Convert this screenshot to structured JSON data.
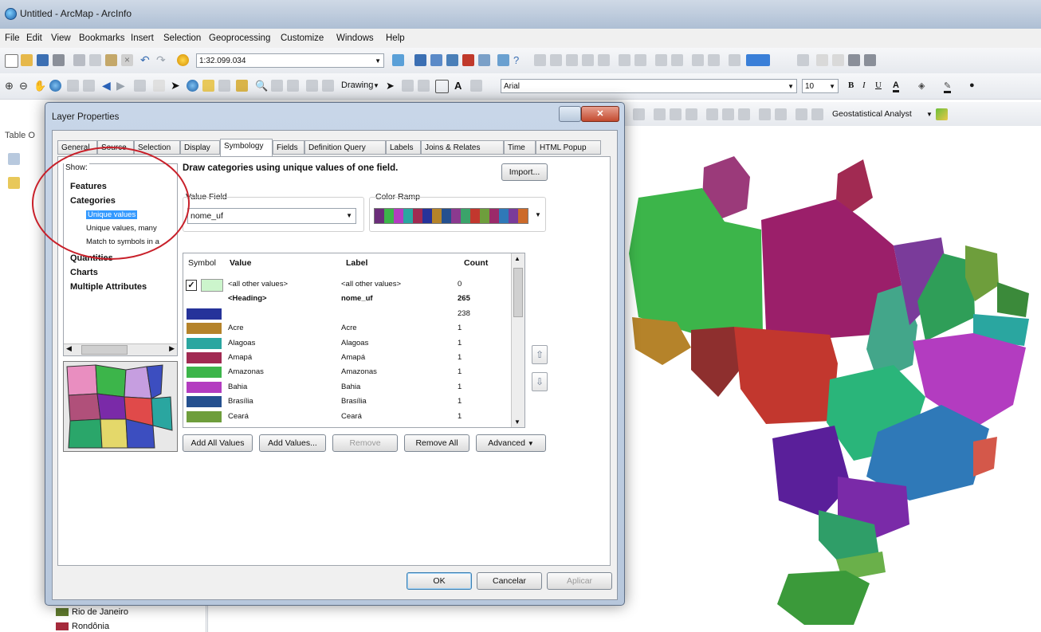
{
  "window": {
    "title": "Untitled - ArcMap - ArcInfo"
  },
  "menu": [
    "File",
    "Edit",
    "View",
    "Bookmarks",
    "Insert",
    "Selection",
    "Geoprocessing",
    "Customize",
    "Windows",
    "Help"
  ],
  "toolbar": {
    "scale": "1:32.099.034",
    "drawing_label": "Drawing",
    "font_name": "Arial",
    "font_size": "10",
    "geostat_label": "Geostatistical Analyst"
  },
  "toc": {
    "title": "Table O",
    "legend_items": [
      {
        "label": "Rio de Janeiro",
        "color": "#5f7a2e"
      },
      {
        "label": "Rondônia",
        "color": "#a52a3b"
      }
    ]
  },
  "dialog": {
    "title": "Layer Properties",
    "tabs": [
      "General",
      "Source",
      "Selection",
      "Display",
      "Symbology",
      "Fields",
      "Definition Query",
      "Labels",
      "Joins & Relates",
      "Time",
      "HTML Popup"
    ],
    "active_tab": "Symbology",
    "show_label": "Show:",
    "show_items": [
      "Features",
      "Categories",
      "Quantities",
      "Charts",
      "Multiple Attributes"
    ],
    "category_subitems": [
      "Unique values",
      "Unique values, many",
      "Match to symbols in a"
    ],
    "selected_subitem": "Unique values",
    "description": "Draw categories using unique values of one field.",
    "import_button": "Import...",
    "value_field_label": "Value Field",
    "value_field": "nome_uf",
    "color_ramp_label": "Color Ramp",
    "columns": [
      "Symbol",
      "Value",
      "Label",
      "Count"
    ],
    "rows": [
      {
        "value": "<all other values>",
        "label": "<all other values>",
        "count": "0",
        "color": "#ccf5cc",
        "checkbox": true
      },
      {
        "value": "<Heading>",
        "label": "nome_uf",
        "count": "265",
        "color": "",
        "heading": true
      },
      {
        "value": "",
        "label": "",
        "count": "238",
        "color": "#26339a"
      },
      {
        "value": "Acre",
        "label": "Acre",
        "count": "1",
        "color": "#b5832a"
      },
      {
        "value": "Alagoas",
        "label": "Alagoas",
        "count": "1",
        "color": "#2aa6a0"
      },
      {
        "value": "Amapá",
        "label": "Amapá",
        "count": "1",
        "color": "#a12a52"
      },
      {
        "value": "Amazonas",
        "label": "Amazonas",
        "count": "1",
        "color": "#3cb54a"
      },
      {
        "value": "Bahia",
        "label": "Bahia",
        "count": "1",
        "color": "#b33cc0"
      },
      {
        "value": "Brasília",
        "label": "Brasília",
        "count": "1",
        "color": "#25508f"
      },
      {
        "value": "Ceará",
        "label": "Ceará",
        "count": "1",
        "color": "#6e9e3c"
      }
    ],
    "buttons": {
      "add_all": "Add All Values",
      "add_values": "Add Values...",
      "remove": "Remove",
      "remove_all": "Remove All",
      "advanced": "Advanced"
    },
    "footer": {
      "ok": "OK",
      "cancel": "Cancelar",
      "apply": "Aplicar"
    }
  },
  "colors": {
    "ramp": [
      "#6b2d7a",
      "#3cb54a",
      "#b33cc0",
      "#2aa6a0",
      "#a12a52",
      "#26339a",
      "#b5832a",
      "#25508f",
      "#8b3a8f",
      "#3ba36a",
      "#c2372e",
      "#6e9e3c",
      "#9b2a6a",
      "#2f79b8",
      "#7a3b9a",
      "#cc6a2a"
    ],
    "selection_blue": "#3399ff",
    "annotation_red": "#c8202a"
  }
}
